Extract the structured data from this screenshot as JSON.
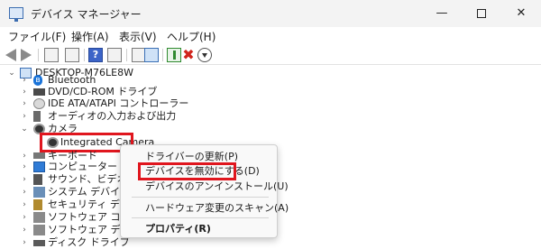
{
  "window": {
    "title": "デバイス マネージャー",
    "minimize": "—",
    "close": "✕"
  },
  "menu": [
    "ファイル(F)",
    "操作(A)",
    "表示(V)",
    "ヘルプ(H)"
  ],
  "toolbar": {
    "icons": [
      "back-arrow",
      "forward-arrow",
      "properties-sheet",
      "show-hide-tree",
      "help",
      "scan-hardware",
      "monitor",
      "update-driver",
      "uninstall-device",
      "download"
    ],
    "help_glyph": "?",
    "uninstall_glyph": "✖"
  },
  "tree": {
    "root": "DESKTOP-M76LE8W",
    "items": [
      {
        "label": "Bluetooth",
        "expanded": false
      },
      {
        "label": "DVD/CD-ROM ドライブ",
        "expanded": false
      },
      {
        "label": "IDE ATA/ATAPI コントローラー",
        "expanded": false
      },
      {
        "label": "オーディオの入力および出力",
        "expanded": false
      },
      {
        "label": "カメラ",
        "expanded": true
      },
      {
        "label": "Integrated Camera",
        "child": true,
        "selected": true
      },
      {
        "label": "キーボード",
        "expanded": false
      },
      {
        "label": "コンピューター",
        "expanded": false
      },
      {
        "label": "サウンド、ビデオ、およびゲーム コントローラー",
        "expanded": false
      },
      {
        "label": "システム デバイス",
        "expanded": false
      },
      {
        "label": "セキュリティ デバイス",
        "expanded": false
      },
      {
        "label": "ソフトウェア コンポーネント",
        "expanded": false
      },
      {
        "label": "ソフトウェア デバイス",
        "expanded": false
      },
      {
        "label": "ディスク ドライブ",
        "expanded": false
      }
    ],
    "bt_glyph": "ʙ"
  },
  "context_menu": {
    "items": [
      {
        "label": "ドライバーの更新(P)"
      },
      {
        "label": "デバイスを無効にする(D)",
        "highlighted": true
      },
      {
        "label": "デバイスのアンインストール(U)"
      },
      {
        "label": "ハードウェア変更のスキャン(A)"
      },
      {
        "label": "プロパティ(R)",
        "bold": true
      }
    ]
  },
  "colors": {
    "highlight_frame": "#e0161e",
    "titlebar_bg": "#f3f3f3",
    "menu_bg": "#f9f9f9"
  }
}
